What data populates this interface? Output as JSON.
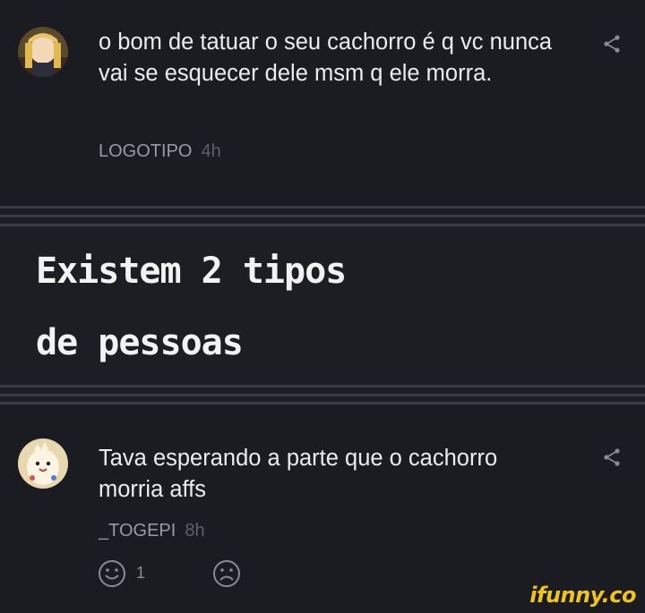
{
  "comments": [
    {
      "text": "o bom de tatuar o seu cachorro é q vc nunca vai se esquecer dele msm q ele morra.",
      "author": "LOGOTIPO",
      "time": "4h",
      "avatar_icon": "anime-girl-avatar",
      "share_icon": "share-icon"
    },
    {
      "text": "Tava esperando a parte que o cachorro morria affs",
      "author": "_TOGEPI",
      "time": "8h",
      "avatar_icon": "togepi-avatar",
      "share_icon": "share-icon",
      "reactions": {
        "like_count": "1",
        "like_icon": "smile-icon",
        "dislike_icon": "frown-icon"
      }
    }
  ],
  "caption": {
    "line1": "Existem 2 tipos",
    "line2": "de pessoas"
  },
  "watermark": "ifunny.co",
  "colors": {
    "background": "#1b1c22",
    "text": "#ececf0",
    "muted": "#9a9aa2",
    "watermark": "#f0c419"
  }
}
